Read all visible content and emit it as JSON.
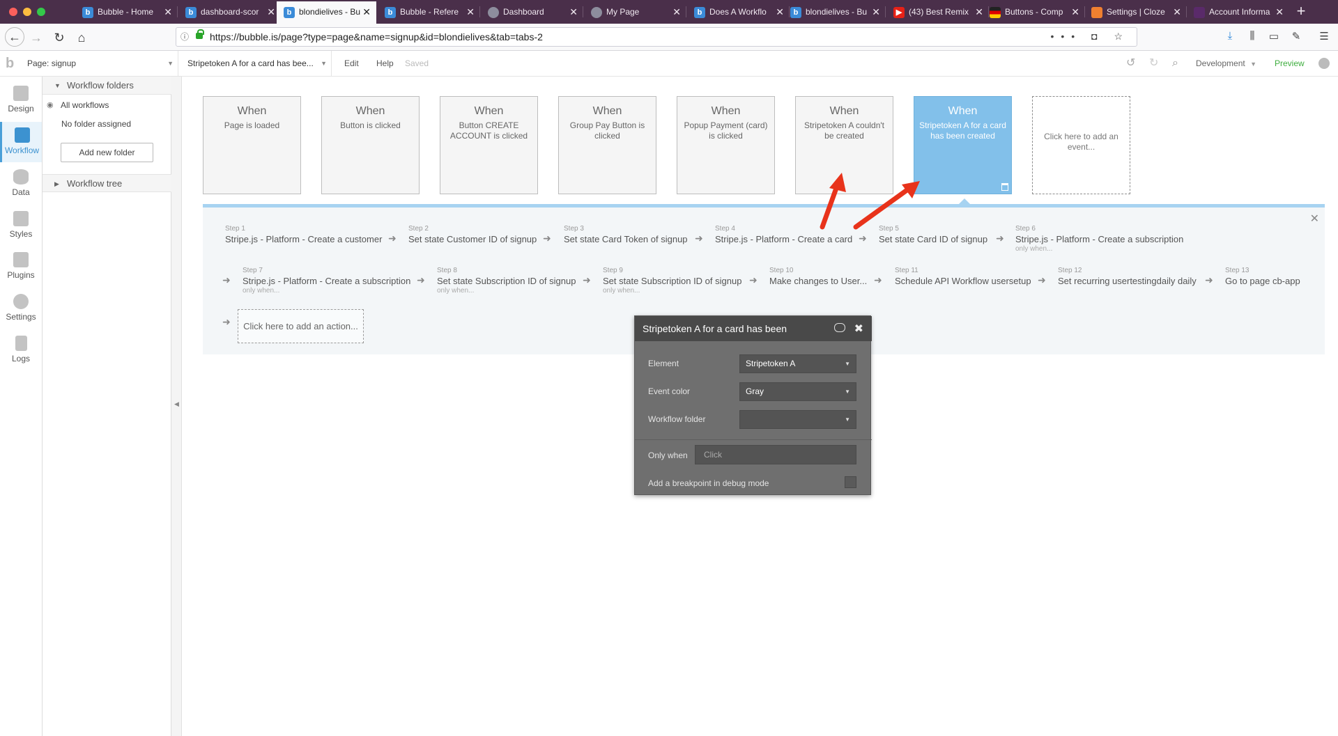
{
  "browser": {
    "tabs": [
      {
        "label": "Bubble - Home",
        "favicon": "bubble-icon",
        "active": false
      },
      {
        "label": "dashboard-scor",
        "favicon": "bubble-icon",
        "active": false
      },
      {
        "label": "blondielives - Bu",
        "favicon": "bubble-icon",
        "active": true
      },
      {
        "label": "Bubble - Refere",
        "favicon": "bubble-icon",
        "active": false
      },
      {
        "label": "Dashboard",
        "favicon": "hexagon-icon",
        "active": false
      },
      {
        "label": "My Page",
        "favicon": "hexagon-icon",
        "active": false
      },
      {
        "label": "Does A Workflo",
        "favicon": "bubble-icon",
        "active": false
      },
      {
        "label": "blondielives - Bu",
        "favicon": "bubble-icon",
        "active": false
      },
      {
        "label": "(43) Best Remix",
        "favicon": "youtube-icon",
        "active": false
      },
      {
        "label": "Buttons - Comp",
        "favicon": "flag-icon",
        "active": false
      },
      {
        "label": "Settings | Cloze",
        "favicon": "cloze-icon",
        "active": false
      },
      {
        "label": "Account Informa",
        "favicon": "account-icon",
        "active": false
      }
    ],
    "url": "https://bubble.is/page?type=page&name=signup&id=blondielives&tab=tabs-2"
  },
  "editor": {
    "page_selector": "Page: signup",
    "workflow_selector": "Stripetoken A for a card has bee...",
    "menu": {
      "edit": "Edit",
      "help": "Help",
      "status": "Saved"
    },
    "environment": "Development",
    "preview": "Preview"
  },
  "leftnav": [
    "Design",
    "Workflow",
    "Data",
    "Styles",
    "Plugins",
    "Settings",
    "Logs"
  ],
  "sidepanel": {
    "folders_header": "Workflow folders",
    "all_workflows": "All workflows",
    "no_folder": "No folder assigned",
    "add_folder": "Add new folder",
    "tree_header": "Workflow tree"
  },
  "events": [
    {
      "when": "When",
      "desc": "Page is loaded"
    },
    {
      "when": "When",
      "desc": "Button is clicked"
    },
    {
      "when": "When",
      "desc": "Button CREATE ACCOUNT is clicked"
    },
    {
      "when": "When",
      "desc": "Group Pay Button is clicked"
    },
    {
      "when": "When",
      "desc": "Popup Payment (card) is clicked"
    },
    {
      "when": "When",
      "desc": "Stripetoken A couldn't be created"
    },
    {
      "when": "When",
      "desc": "Stripetoken A for a card has been created",
      "selected": true
    },
    {
      "add": "Click here to add an event..."
    }
  ],
  "steps": [
    {
      "num": "Step 1",
      "title": "Stripe.js - Platform - Create a customer",
      "cond": ""
    },
    {
      "num": "Step 2",
      "title": "Set state Customer ID of signup",
      "cond": ""
    },
    {
      "num": "Step 3",
      "title": "Set state Card Token of signup",
      "cond": ""
    },
    {
      "num": "Step 4",
      "title": "Stripe.js - Platform - Create a card",
      "cond": ""
    },
    {
      "num": "Step 5",
      "title": "Set state Card ID of signup",
      "cond": ""
    },
    {
      "num": "Step 6",
      "title": "Stripe.js - Platform - Create a subscription",
      "cond": "only when..."
    },
    {
      "num": "Step 7",
      "title": "Stripe.js - Platform - Create a subscription",
      "cond": "only when..."
    },
    {
      "num": "Step 8",
      "title": "Set state Subscription ID of signup",
      "cond": "only when..."
    },
    {
      "num": "Step 9",
      "title": "Set state Subscription ID of signup",
      "cond": "only when..."
    },
    {
      "num": "Step 10",
      "title": "Make changes to User...",
      "cond": ""
    },
    {
      "num": "Step 11",
      "title": "Schedule API Workflow usersetup",
      "cond": ""
    },
    {
      "num": "Step 12",
      "title": "Set recurring usertestingdaily daily",
      "cond": ""
    },
    {
      "num": "Step 13",
      "title": "Go to page cb-app",
      "cond": ""
    }
  ],
  "add_action": "Click here to add an action...",
  "popup": {
    "title": "Stripetoken A for a card has been",
    "element_label": "Element",
    "element_value": "Stripetoken A",
    "color_label": "Event color",
    "color_value": "Gray",
    "folder_label": "Workflow folder",
    "folder_value": "",
    "only_when_label": "Only when",
    "only_when_placeholder": "Click",
    "breakpoint_label": "Add a breakpoint in debug mode"
  },
  "colors": {
    "accent": "#3c92d0",
    "selected_event": "#82c0ea",
    "annotation_arrow": "#e8331b",
    "tabbar": "#4a2f4a"
  }
}
